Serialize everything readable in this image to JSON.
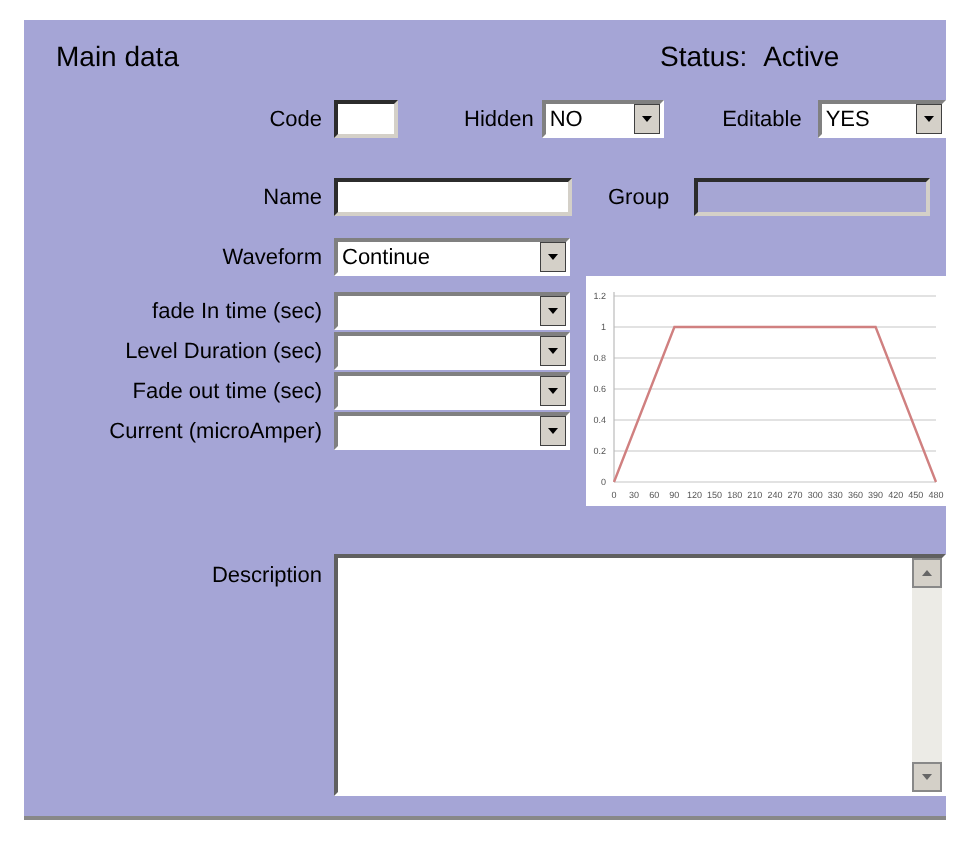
{
  "header": {
    "title": "Main data",
    "status_label": "Status:",
    "status_value": "Active"
  },
  "code": {
    "label": "Code"
  },
  "hidden": {
    "label": "Hidden",
    "value": "NO"
  },
  "editable": {
    "label": "Editable",
    "value": "YES"
  },
  "name": {
    "label": "Name"
  },
  "group": {
    "label": "Group",
    "disabled": true
  },
  "waveform": {
    "label": "Waveform",
    "value": "Continue"
  },
  "parameters": [
    {
      "label": "fade In time (sec)"
    },
    {
      "label": "Level Duration  (sec)"
    },
    {
      "label": "Fade out time  (sec)"
    },
    {
      "label": "Current (microAmper)"
    }
  ],
  "chart_data": {
    "type": "line",
    "x": [
      0,
      90,
      390,
      480
    ],
    "series": [
      {
        "color": "#d08080",
        "values": [
          0,
          1,
          1,
          0
        ]
      }
    ],
    "grid": true,
    "xlim": [
      0,
      480
    ],
    "ylim": [
      0,
      1.2
    ],
    "xticks": [
      0,
      30,
      60,
      90,
      120,
      150,
      180,
      210,
      240,
      270,
      300,
      330,
      360,
      390,
      420,
      450,
      480
    ],
    "yticks": [
      0,
      0.2,
      0.4,
      0.6,
      0.8,
      1,
      1.2
    ]
  },
  "description": {
    "label": "Description"
  }
}
